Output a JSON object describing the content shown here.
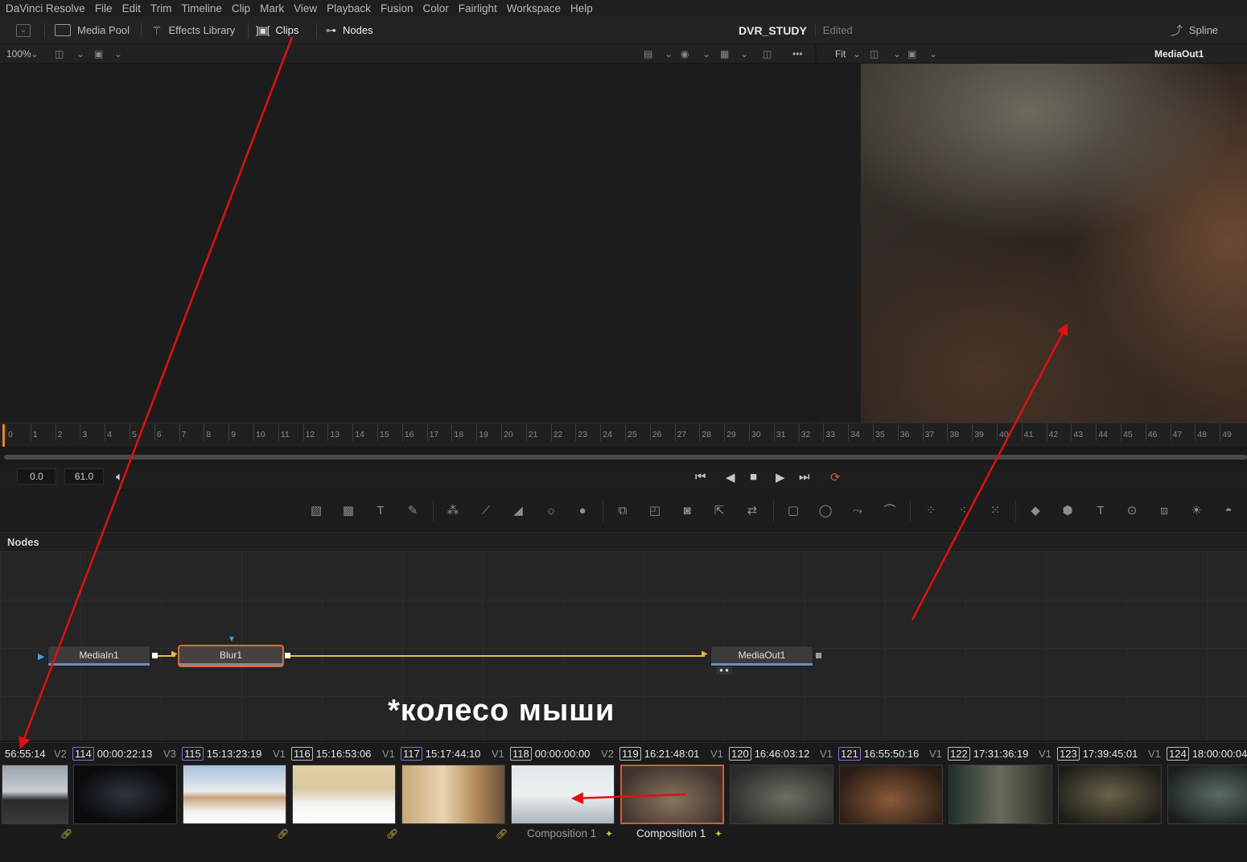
{
  "menu": [
    "DaVinci Resolve",
    "File",
    "Edit",
    "Trim",
    "Timeline",
    "Clip",
    "Mark",
    "View",
    "Playback",
    "Fusion",
    "Color",
    "Fairlight",
    "Workspace",
    "Help"
  ],
  "toolbar": {
    "media_pool": "Media Pool",
    "effects_library": "Effects Library",
    "clips": "Clips",
    "nodes": "Nodes",
    "project_name": "DVR_STUDY",
    "project_status": "Edited",
    "spline": "Spline"
  },
  "viewer": {
    "zoom_left": "100%",
    "zoom_right": "Fit",
    "right_title": "MediaOut1"
  },
  "ruler": {
    "ticks": [
      "0",
      "1",
      "2",
      "3",
      "4",
      "5",
      "6",
      "7",
      "8",
      "9",
      "10",
      "11",
      "12",
      "13",
      "14",
      "15",
      "16",
      "17",
      "18",
      "19",
      "20",
      "21",
      "22",
      "23",
      "24",
      "25",
      "26",
      "27",
      "28",
      "29",
      "30",
      "31",
      "32",
      "33",
      "34",
      "35",
      "36",
      "37",
      "38",
      "39",
      "40",
      "41",
      "42",
      "43",
      "44",
      "45",
      "46",
      "47",
      "48",
      "49"
    ]
  },
  "transport": {
    "start": "0.0",
    "end": "61.0"
  },
  "nodes_panel": {
    "title": "Nodes",
    "nodes": {
      "media_in": "MediaIn1",
      "blur": "Blur1",
      "media_out": "MediaOut1"
    }
  },
  "caption": "*колесо мыши",
  "clips": [
    {
      "num": "",
      "time": "56:55:14",
      "track": "V2",
      "footer": ""
    },
    {
      "num": "114",
      "time": "00:00:22:13",
      "track": "V3",
      "footer": ""
    },
    {
      "num": "115",
      "time": "15:13:23:19",
      "track": "V1",
      "footer": ""
    },
    {
      "num": "116",
      "time": "15:16:53:06",
      "track": "V1",
      "footer": ""
    },
    {
      "num": "117",
      "time": "15:17:44:10",
      "track": "V1",
      "footer": ""
    },
    {
      "num": "118",
      "time": "00:00:00:00",
      "track": "V2",
      "footer": "Composition 1"
    },
    {
      "num": "119",
      "time": "16:21:48:01",
      "track": "V1",
      "footer": "Composition 1"
    },
    {
      "num": "120",
      "time": "16:46:03:12",
      "track": "V1",
      "footer": ""
    },
    {
      "num": "121",
      "time": "16:55:50:16",
      "track": "V1",
      "footer": ""
    },
    {
      "num": "122",
      "time": "17:31:36:19",
      "track": "V1",
      "footer": ""
    },
    {
      "num": "123",
      "time": "17:39:45:01",
      "track": "V1",
      "footer": ""
    },
    {
      "num": "124",
      "time": "18:00:00:04",
      "track": "",
      "footer": ""
    }
  ],
  "colors": {
    "accent_orange": "#e07b3a",
    "annotation_red": "#e01010",
    "connection_yellow": "#e5b84a",
    "node_bar_blue": "#6e8fbf"
  }
}
